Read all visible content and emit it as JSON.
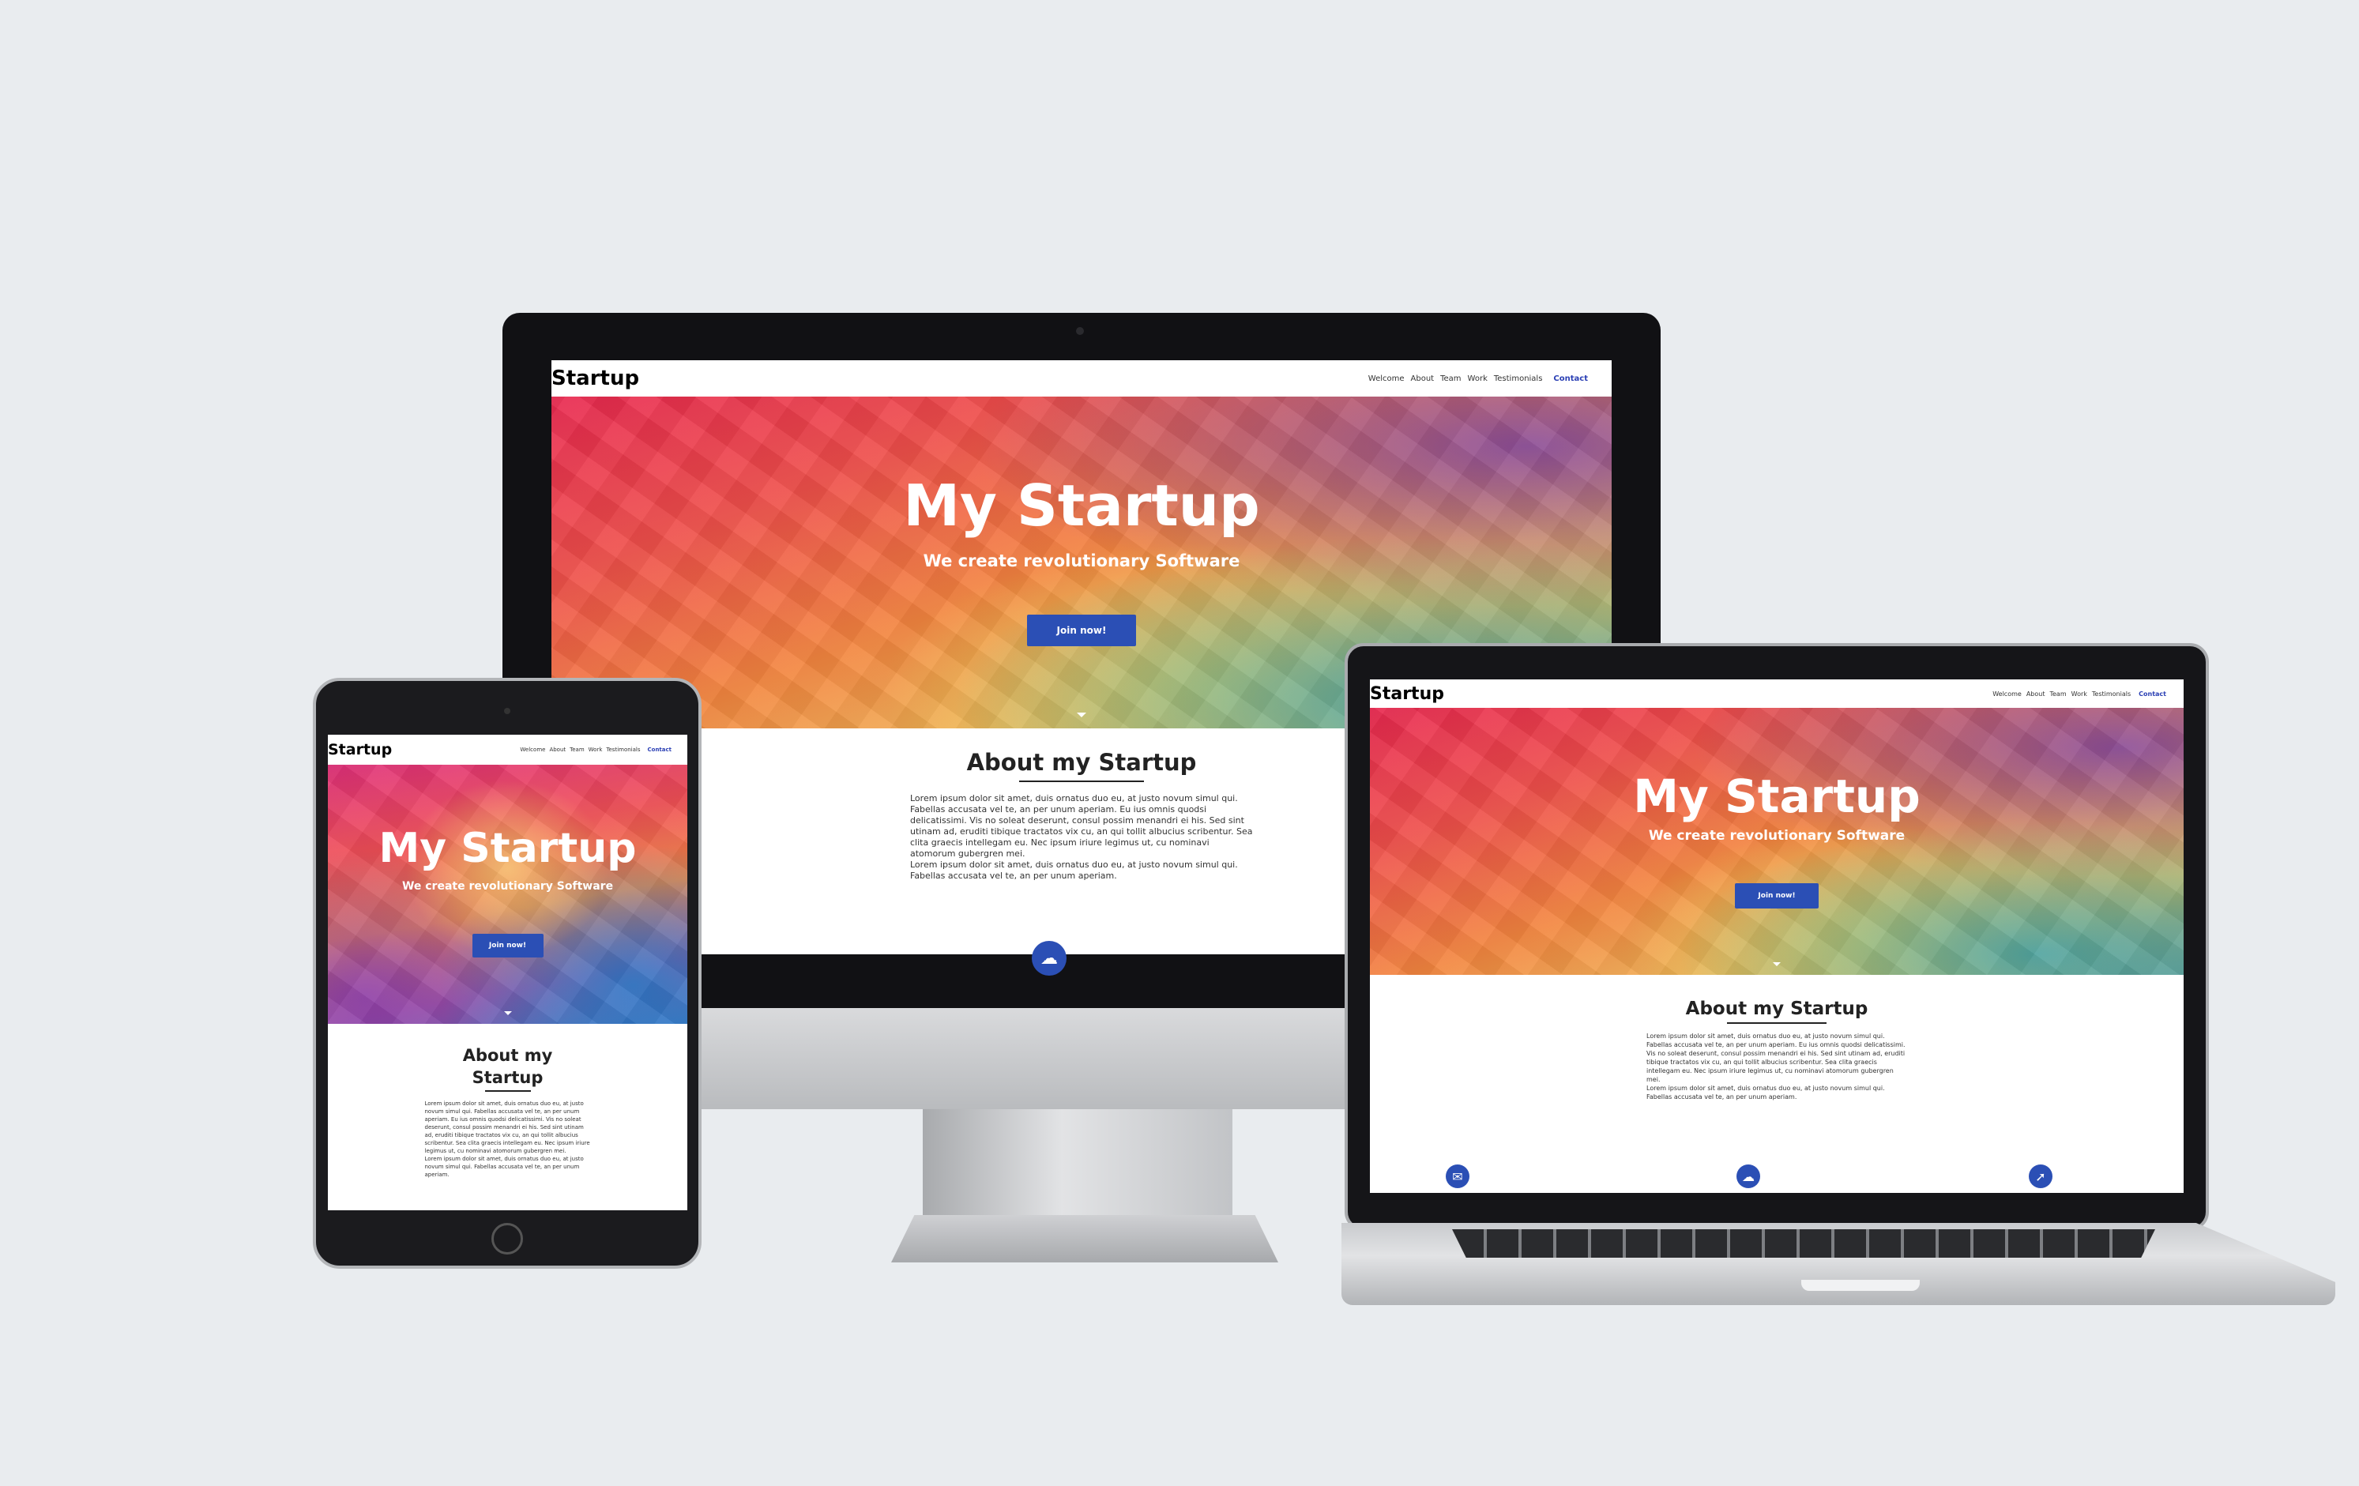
{
  "site": {
    "logo": "Startup",
    "nav": [
      "Welcome",
      "About",
      "Team",
      "Work",
      "Testimonials",
      "Contact"
    ],
    "hero_title": "My Startup",
    "hero_subtitle": "We create revolutionary Software",
    "cta_label": "Join now!",
    "about_title": "About my Startup",
    "about_title_line1": "About my",
    "about_title_line2": "Startup",
    "about_text": "Lorem ipsum dolor sit amet, duis ornatus duo eu, at justo novum simul qui. Fabellas accusata vel te, an per unum aperiam. Eu ius omnis quodsi delicatissimi. Vis no soleat deserunt, consul possim menandri ei his. Sed sint utinam ad, eruditi tibique tractatos vix cu, an qui tollit albucius scribentur. Sea clita graecis intellegam eu. Nec ipsum iriure legimus ut, cu nominavi atomorum gubergren mei.",
    "about_text_2": "Lorem ipsum dolor sit amet, duis ornatus duo eu, at justo novum simul qui. Fabellas accusata vel te, an per unum aperiam.",
    "feature_icons": [
      "envelope-icon",
      "cloud-icon",
      "compass-icon"
    ]
  },
  "colors": {
    "accent": "#2b4fb5",
    "contact_link": "#2a3fb4",
    "background": "#e9ecef"
  }
}
